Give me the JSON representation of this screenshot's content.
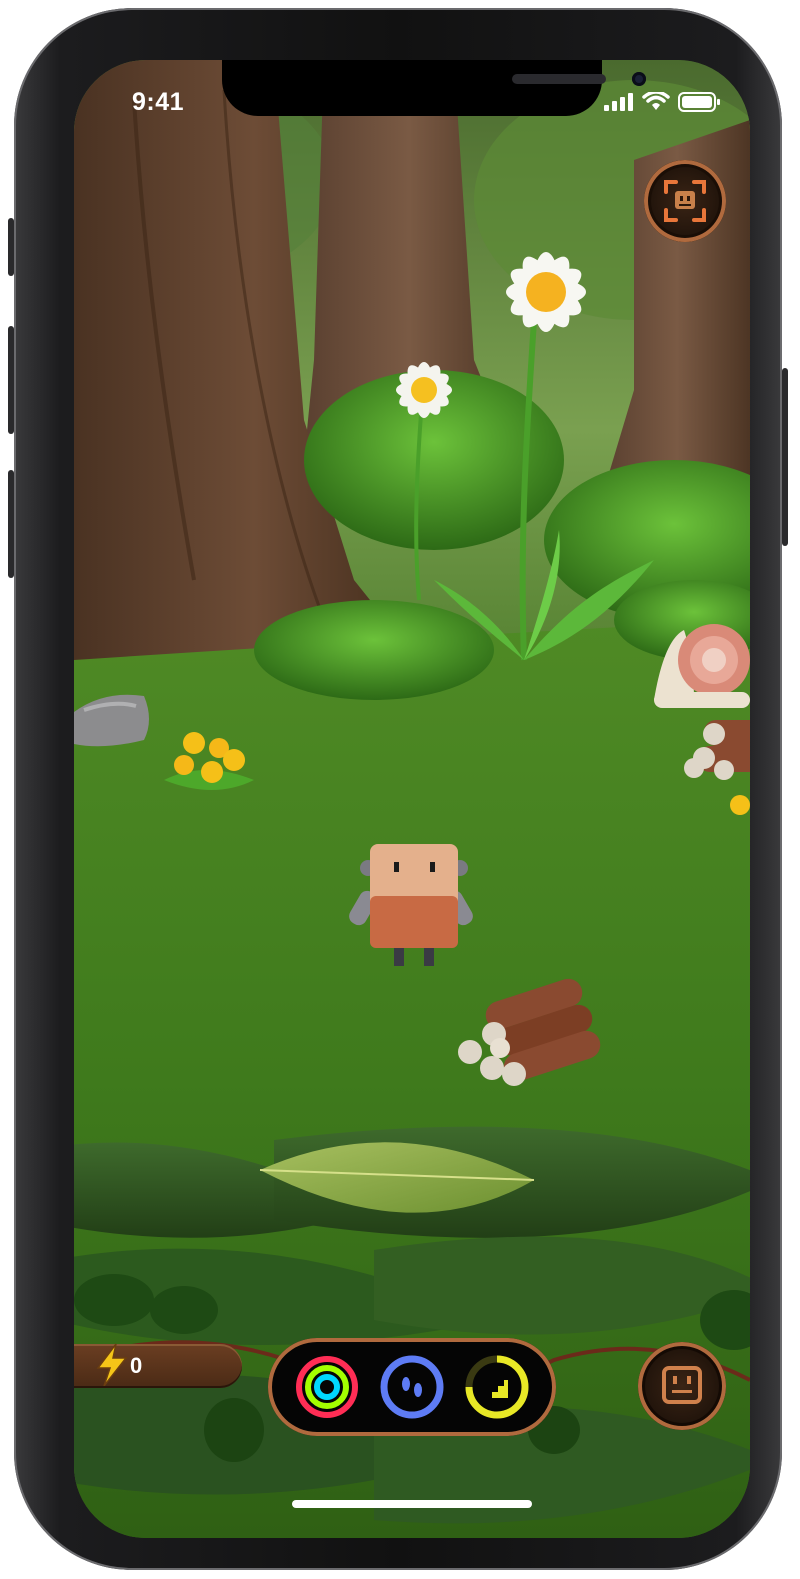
{
  "status_bar": {
    "time": "9:41"
  },
  "hud": {
    "energy_value": "0",
    "ar_button_icon": "ar-scan-icon",
    "character_button_icon": "robot-face-icon"
  },
  "activity_rings": [
    {
      "name": "activity-ring",
      "colors": [
        "#ff2d55",
        "#a4ff00",
        "#00d7ff"
      ]
    },
    {
      "name": "steps",
      "color": "#5e7cf5"
    },
    {
      "name": "stairs",
      "color": "#e8e826"
    }
  ],
  "colors": {
    "frame_accent": "#b06a3e",
    "energy_bolt": "#f5c518"
  }
}
